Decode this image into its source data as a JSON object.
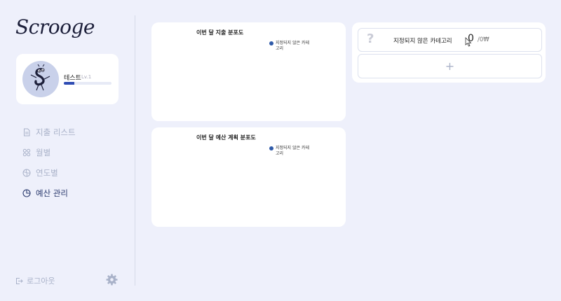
{
  "app": {
    "logo": "Scrooge"
  },
  "profile": {
    "name": "테스트",
    "level": "Lv.1",
    "level_progress": 0.22
  },
  "nav": {
    "items": [
      {
        "id": "expense-list",
        "label": "지출 리스트",
        "icon": "document-icon",
        "active": false
      },
      {
        "id": "monthly",
        "label": "월별",
        "icon": "grid-icon",
        "active": false
      },
      {
        "id": "yearly",
        "label": "연도별",
        "icon": "globe-icon",
        "active": false
      },
      {
        "id": "budget",
        "label": "예산 관리",
        "icon": "pie-chart-icon",
        "active": true
      }
    ]
  },
  "footer": {
    "logout_label": "로그아웃",
    "settings_icon": "gear-icon"
  },
  "charts": {
    "spending": {
      "title": "이번 달 지출 분포도",
      "legend": "지정되지 않은 카테고리"
    },
    "budget": {
      "title": "이번 달 예산 계획 분포도",
      "legend": "지정되지 않은 카테고리"
    }
  },
  "categories": [
    {
      "icon": "?",
      "name": "지정되지 않은 카테고리",
      "amount": "0",
      "budget": "/0₩"
    }
  ],
  "add_label": "+",
  "colors": {
    "accent": "#2f4cb3",
    "legend_dot": "#2f5aa8",
    "background": "#eef0fb"
  }
}
